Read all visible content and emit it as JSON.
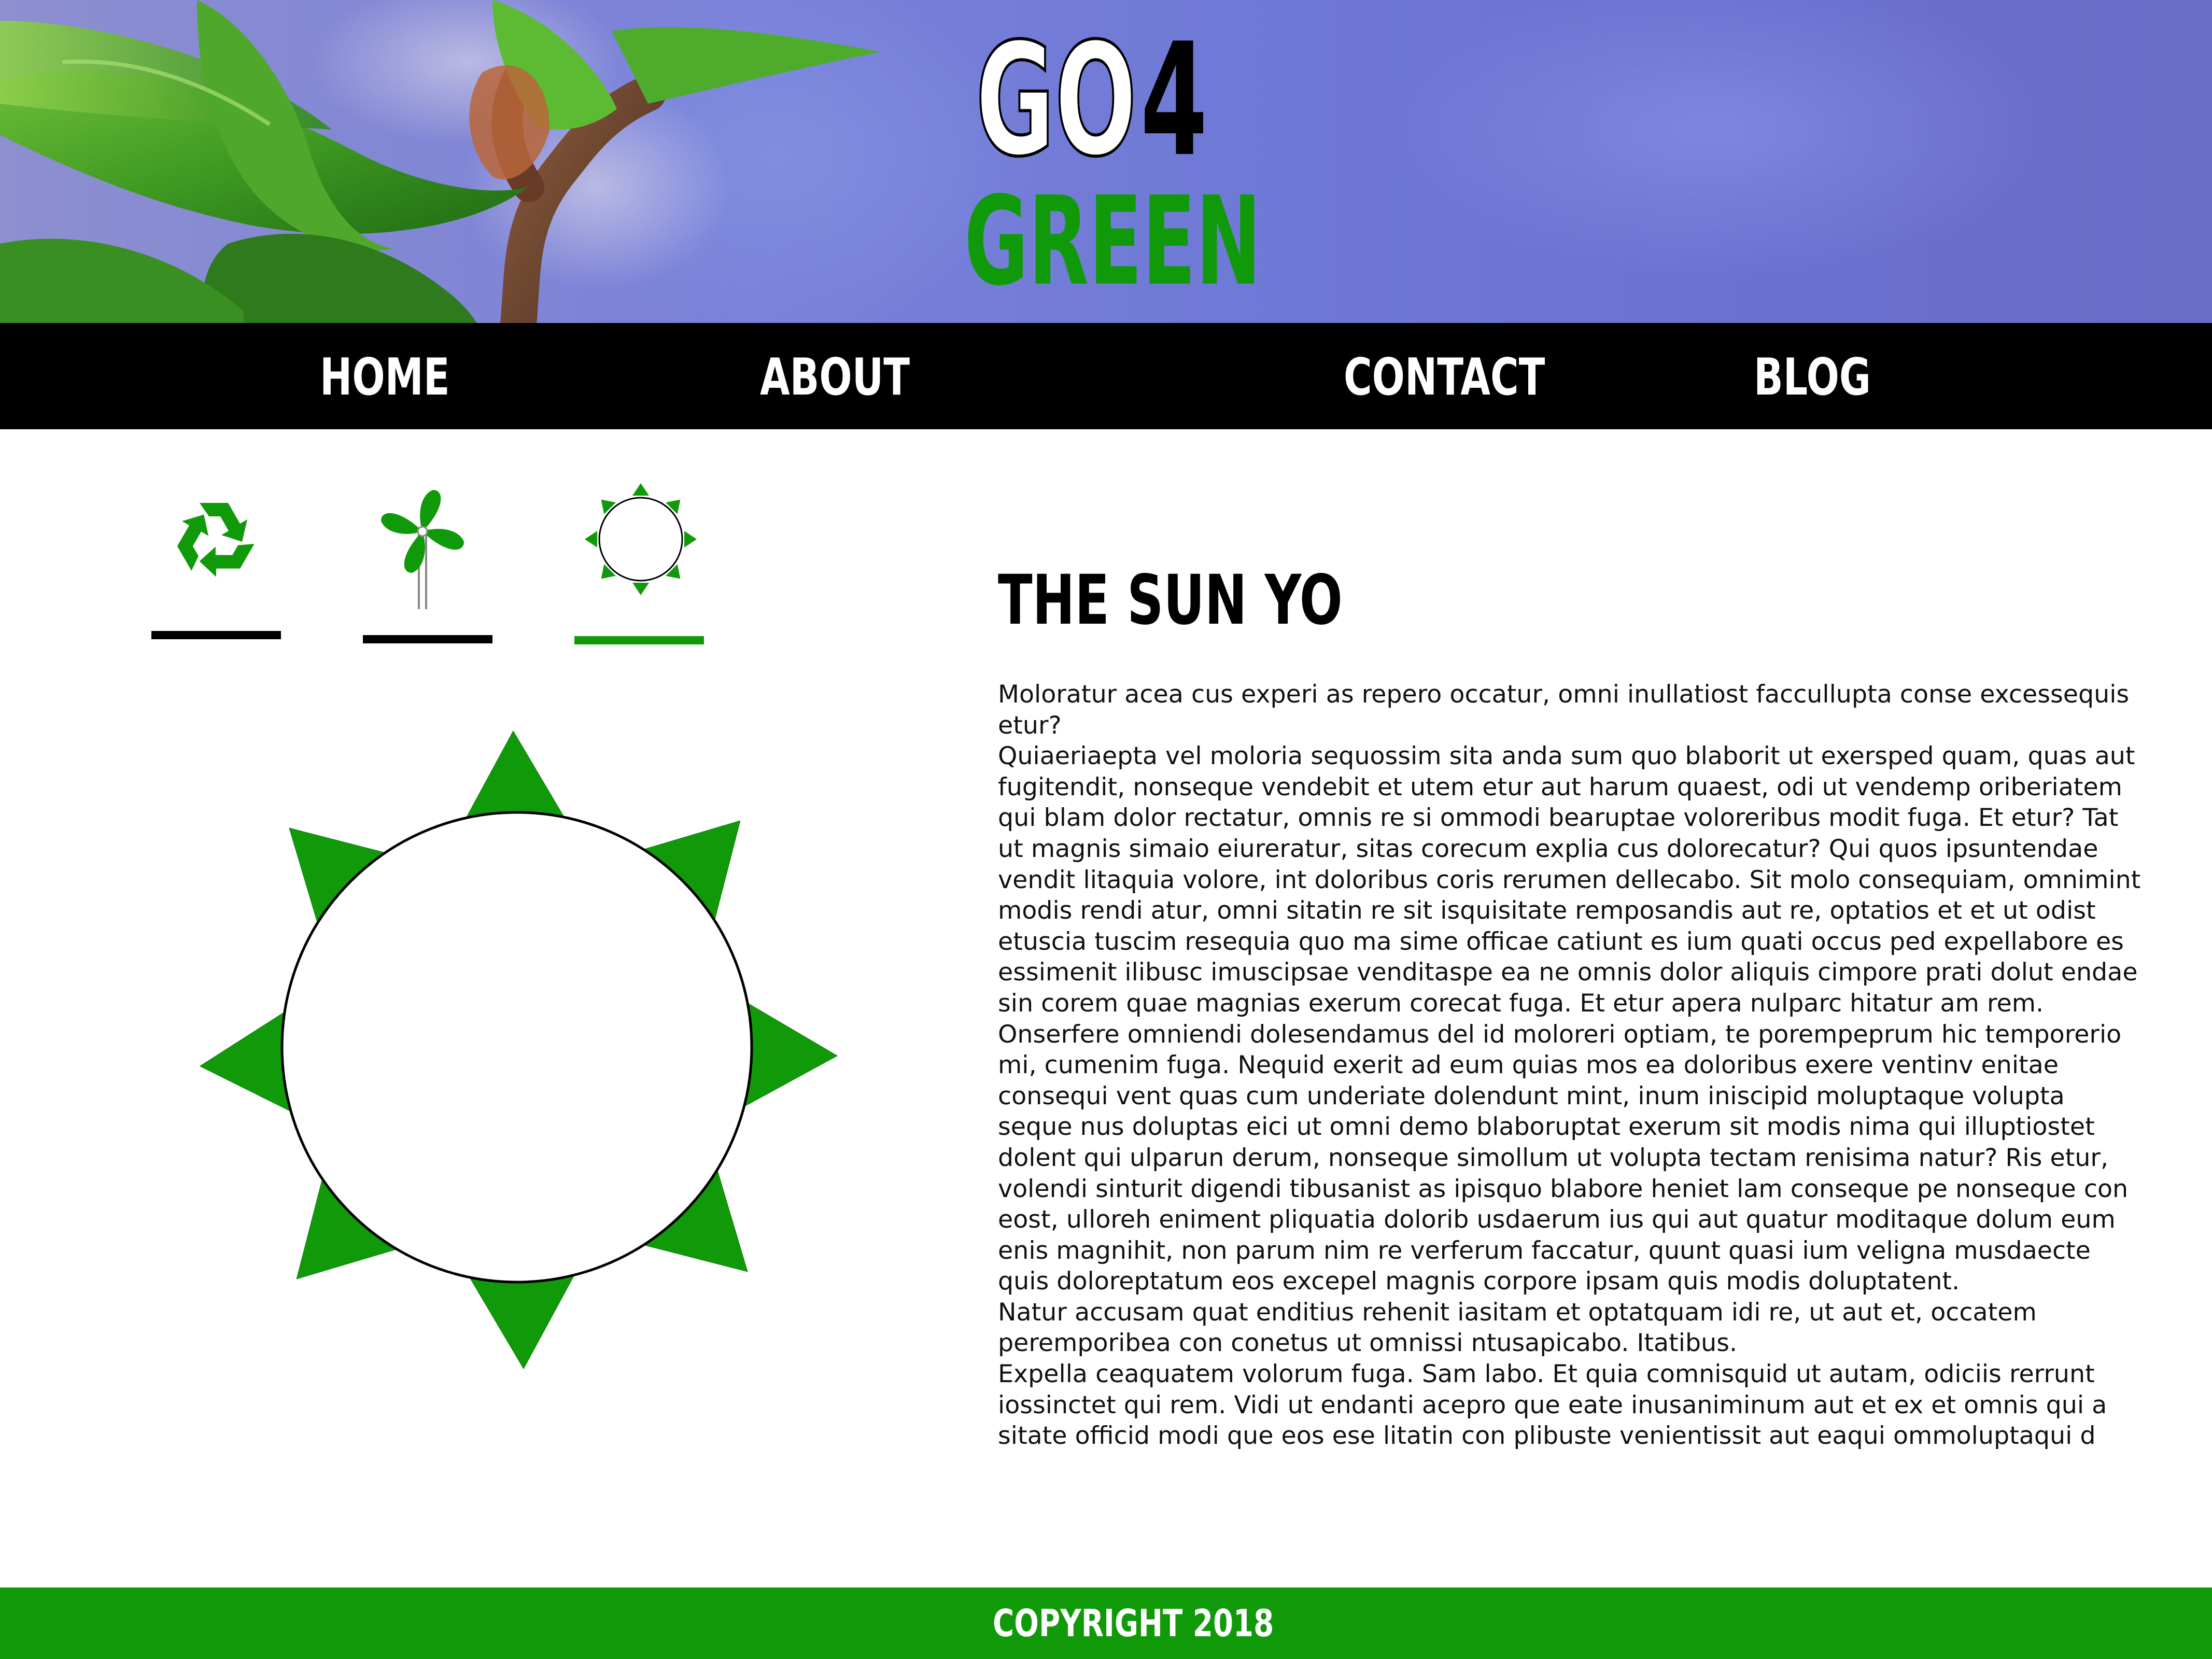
{
  "brand": {
    "logo_go": "GO",
    "logo_number": "4",
    "logo_green": "GREEN",
    "brand_color": "#109a09"
  },
  "nav": {
    "items": [
      {
        "label": "HOME"
      },
      {
        "label": "ABOUT"
      },
      {
        "label": "CONTACT"
      },
      {
        "label": "BLOG"
      }
    ]
  },
  "icon_tabs": [
    {
      "icon": "recycle-icon",
      "active": false
    },
    {
      "icon": "pinwheel-icon",
      "active": false
    },
    {
      "icon": "sun-icon",
      "active": true
    }
  ],
  "colors": {
    "accent": "#109a09",
    "nav_bg": "#000000",
    "hero_bg": "#7b82d8"
  },
  "article": {
    "title": "THE SUN YO",
    "body": "Moloratur acea cus experi as repero occatur, omni inullatiost faccullupta conse excessequis etur?\nQuiaeriaepta vel moloria sequossim sita anda sum quo blaborit ut exersped quam, quas aut fugitendit, nonseque vendebit et utem etur aut harum quaest, odi ut vendemp oriberiatem qui blam dolor rectatur, omnis re si ommodi bearuptae voloreribus modit fuga. Et etur? Tat ut magnis simaio eiureratur, sitas corecum explia cus dolorecatur? Qui quos ipsuntendae vendit litaquia volore, int doloribus coris rerumen dellecabo. Sit molo consequiam, omnimint modis rendi atur, omni sitatin re sit isquisitate remposandis aut re, optatios et et ut odist etuscia tuscim resequia quo ma sime officae catiunt es ium quati occus ped expellabore es essimenit ilibusc imuscipsae venditaspe ea ne omnis dolor aliquis cimpore prati dolut endae sin corem quae magnias exerum corecat fuga. Et etur apera nulparc hitatur am rem. Onserfere omniendi dolesendamus del id moloreri optiam, te porempерrum hic temporerio mi, cumenim fuga. Nequid exerit ad eum quias mos ea doloribus exere ventinv enitae consequi vent quas cum underiate dolendunt mint, inum iniscipid moluptaque volupta seque nus doluptas eici ut omni demo blaboruptat exerum sit modis nima qui illuptiostet dolent qui ulparun derum, nonseque simollum ut volupta tectam renisima natur? Ris etur, volendi sinturit digendi tibusanist as ipisquo blabore heniet lam conseque pe nonseque con eost, ulloreh eniment pliquatia dolorib usdaerum ius qui aut quatur moditaque dolum eum enis magnihit, non parum nim re verferum faccatur, quunt quasi ium veligna musdaecte quis doloreptatum eos excepel magnis corpore ipsam quis modis doluptatent.\nNatur accusam quat enditius rehenit iasitam et optatquam idi re, ut aut et, occatem perempo­ribea con conetus ut omnissi ntusapicabo. Itatibus.\nExpella ceaquatem volorum fuga. Sam labo. Et quia comnisquid ut autam, odiciis rerrunt iossinctet qui rem. Vidi ut endanti acepro que eate inusaniminum aut et ex et omnis qui a sitate officid modi que eos ese litatin con plibuste venientissit aut eaqui ommoluptaqui d"
  },
  "footer": {
    "copyright": "COPYRIGHT 2018"
  }
}
